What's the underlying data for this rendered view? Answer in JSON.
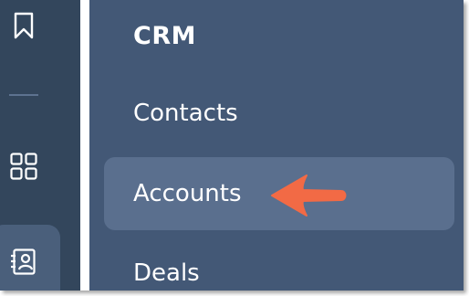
{
  "rail": {
    "icons": [
      "bookmark-icon",
      "grid-icon",
      "contact-card-icon"
    ],
    "active": "contact-card-icon"
  },
  "panel": {
    "title": "CRM",
    "items": [
      {
        "label": "Contacts",
        "active": false
      },
      {
        "label": "Accounts",
        "active": true
      },
      {
        "label": "Deals",
        "active": false
      }
    ]
  },
  "annotation": {
    "icon": "arrow-left-icon",
    "target": "Accounts",
    "color": "#f26a45"
  },
  "colors": {
    "rail_bg": "#33465c",
    "panel_bg": "#435876",
    "active_item_bg": "#5a6f8e",
    "text": "#ffffff"
  }
}
